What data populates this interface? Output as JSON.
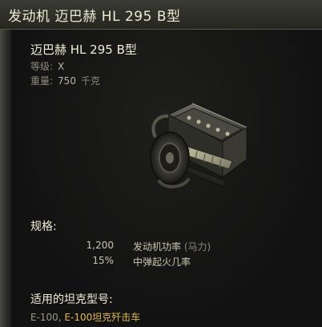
{
  "window": {
    "title": "发动机 迈巴赫 HL 295 B型"
  },
  "module": {
    "name": "迈巴赫 HL 295 B型",
    "tier_label": "等级:",
    "tier_value": "X",
    "weight_label": "重量:",
    "weight_value": "750",
    "weight_unit": "千克",
    "image_icon": "engine-icon"
  },
  "specs": {
    "title": "规格:",
    "rows": [
      {
        "value": "1,200",
        "name": "发动机功率",
        "unit": "(马力)"
      },
      {
        "value": "15%",
        "name": "中弹起火几率",
        "unit": ""
      }
    ]
  },
  "compatible": {
    "title": "适用的坦克型号:",
    "tank_1": "E-100",
    "separator": ", ",
    "tank_2": "E-100坦克歼击车"
  },
  "colors": {
    "highlight": "#e3b84a",
    "title_text": "#f0ead2",
    "muted_text": "#8e8a7a"
  }
}
